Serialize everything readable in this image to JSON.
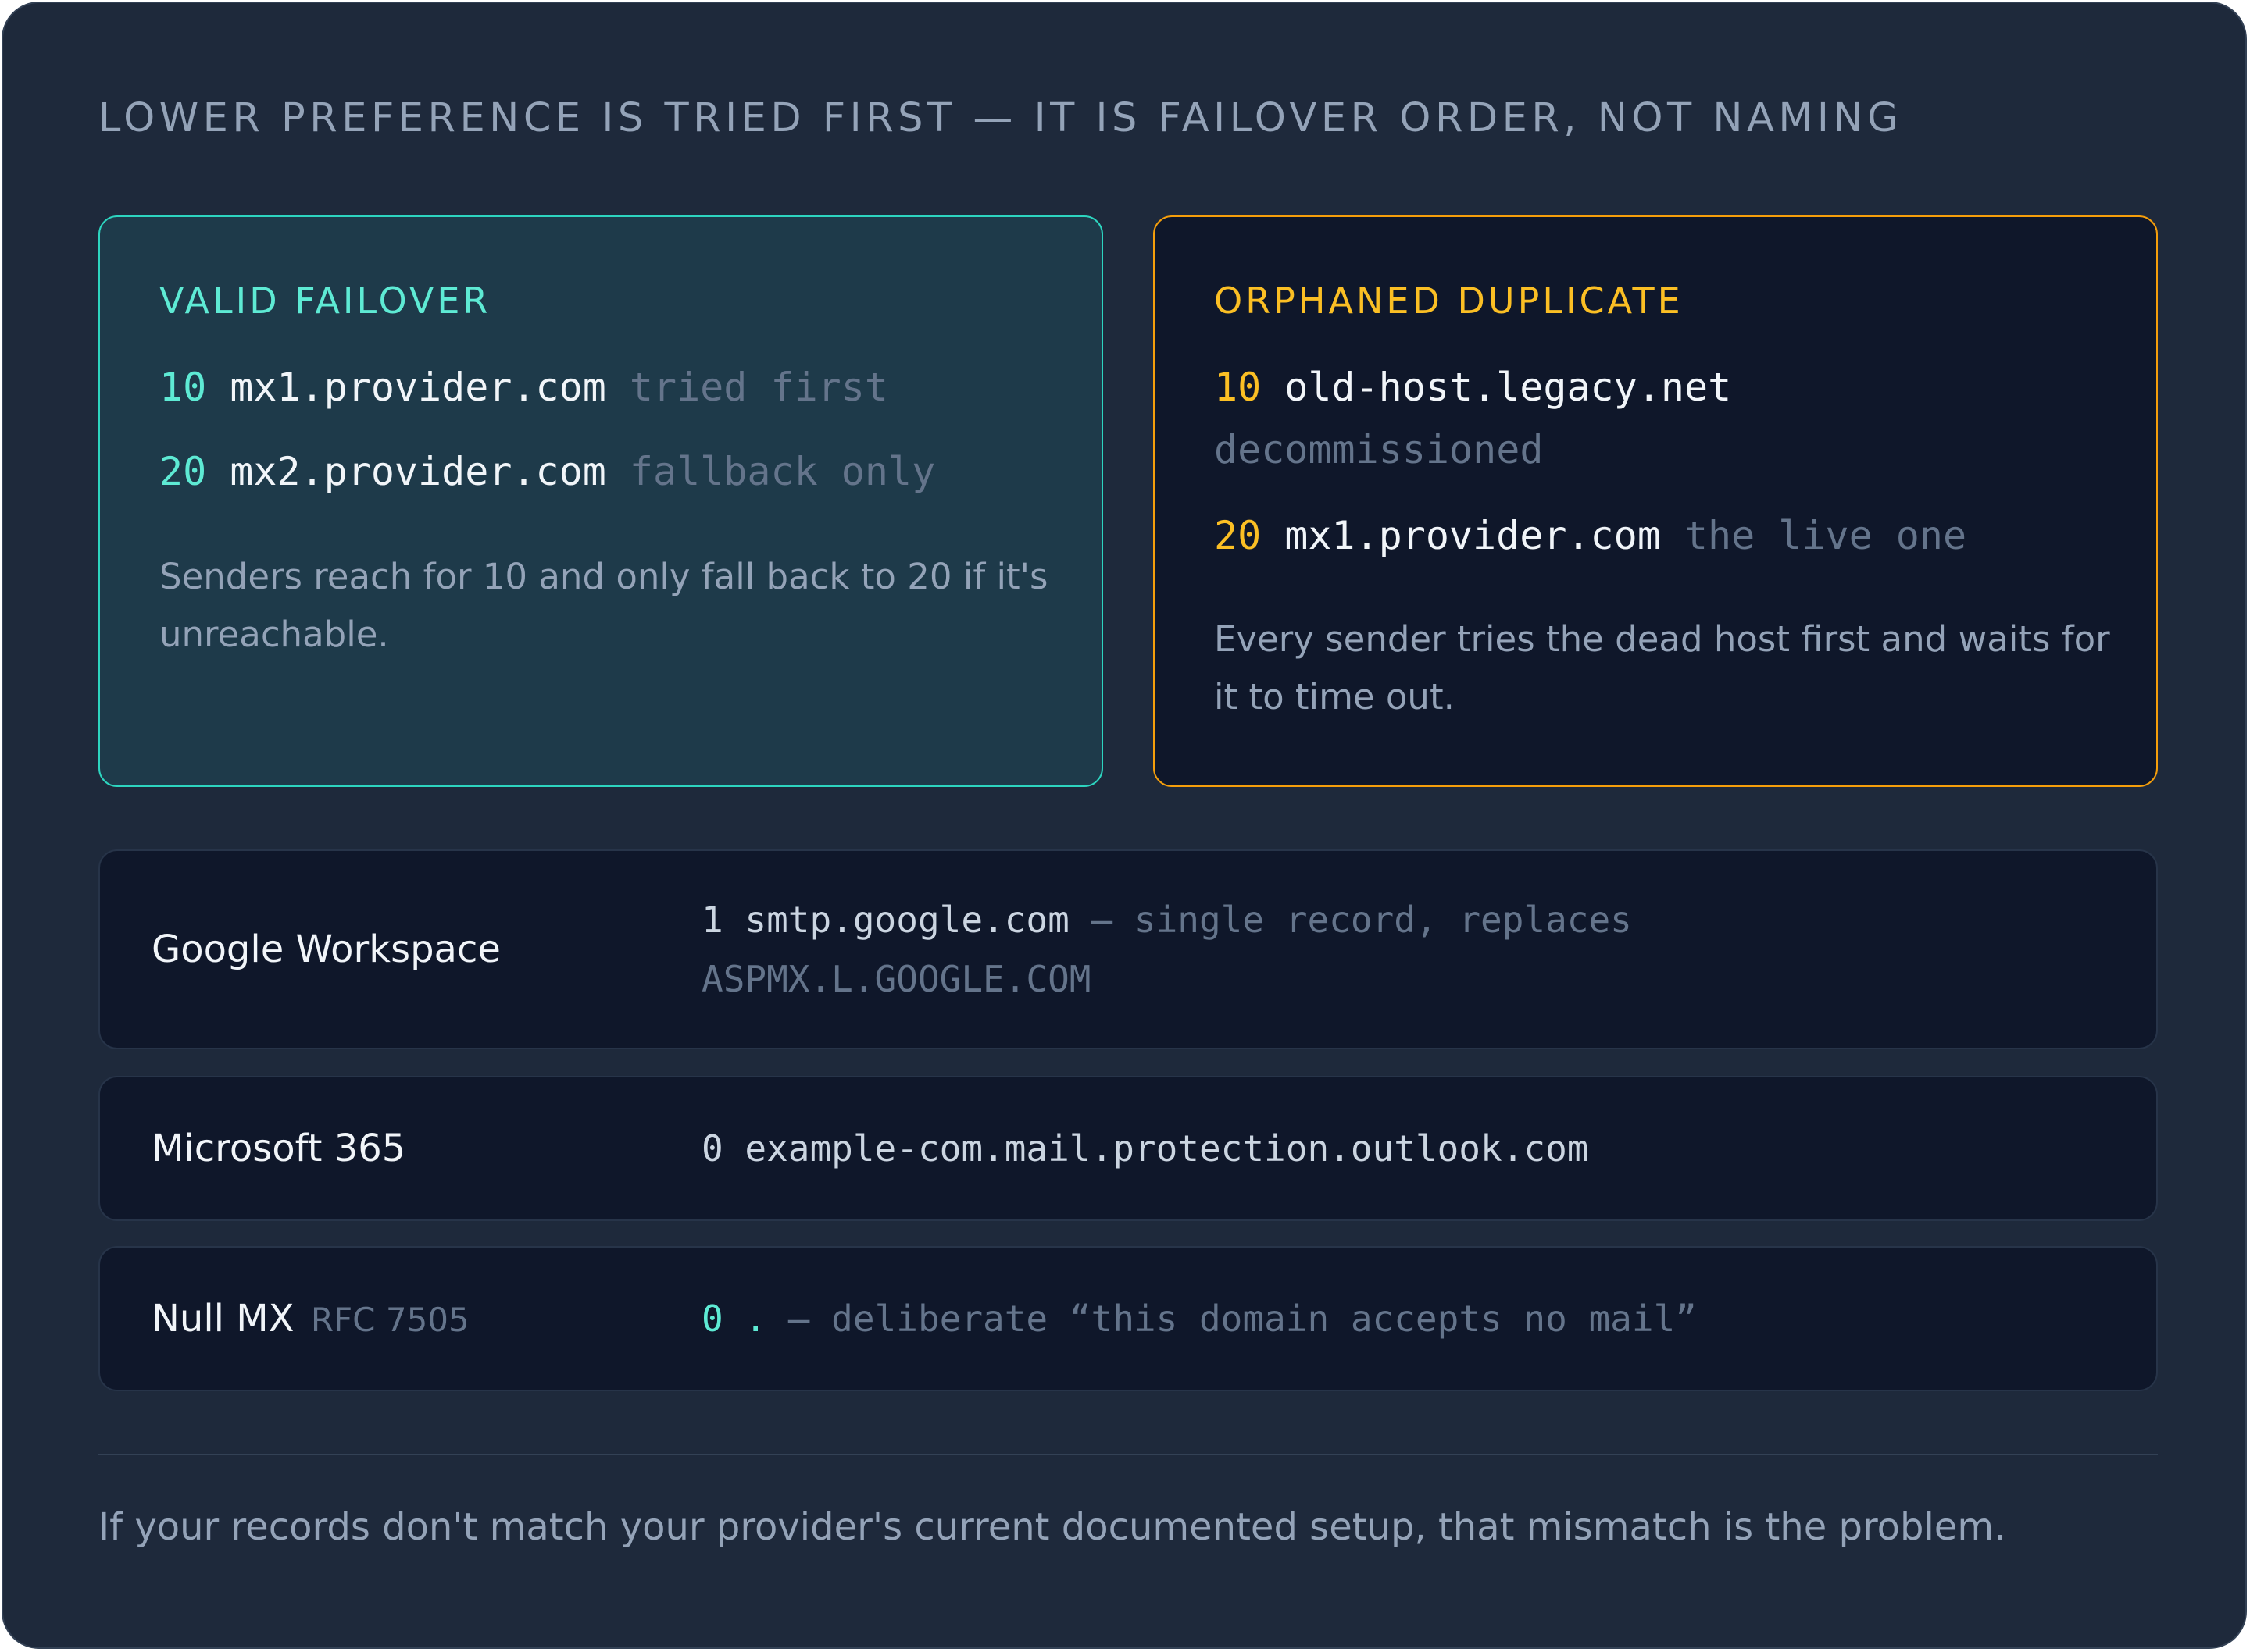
{
  "heading": "LOWER PREFERENCE IS TRIED FIRST — IT IS FAILOVER ORDER, NOT NAMING",
  "valid_failover": {
    "title": "VALID FAILOVER",
    "records": [
      {
        "preference": "10",
        "host": "mx1.provider.com",
        "note": "tried first"
      },
      {
        "preference": "20",
        "host": "mx2.provider.com",
        "note": "fallback only"
      }
    ],
    "description": "Senders reach for 10 and only fall back to 20 if it's unreachable."
  },
  "orphaned_duplicate": {
    "title": "ORPHANED DUPLICATE",
    "records": [
      {
        "preference": "10",
        "host": "old-host.legacy.net",
        "note": "decommissioned"
      },
      {
        "preference": "20",
        "host": "mx1.provider.com",
        "note": "the live one"
      }
    ],
    "description": "Every sender tries the dead host first and waits for it to time out."
  },
  "providers": [
    {
      "label": "Google Workspace",
      "value_main": "1 smtp.google.com",
      "value_note": "— single record, replaces ASPMX.L.GOOGLE.COM"
    },
    {
      "label": "Microsoft 365",
      "value_main": "0 example-com.mail.protection.outlook.com",
      "value_note": ""
    },
    {
      "label": "Null MX",
      "label_sub": "RFC 7505",
      "value_main": "0 .",
      "value_note": "— deliberate “this domain accepts no mail”"
    }
  ],
  "footer": "If your records don't match your provider's current documented setup, that mismatch is the problem.",
  "colors": {
    "background": "#1e293b",
    "panel": "#0f172a",
    "teal_accent": "#5eead4",
    "amber_accent": "#fbbf24",
    "muted_text": "#94a3b8"
  }
}
